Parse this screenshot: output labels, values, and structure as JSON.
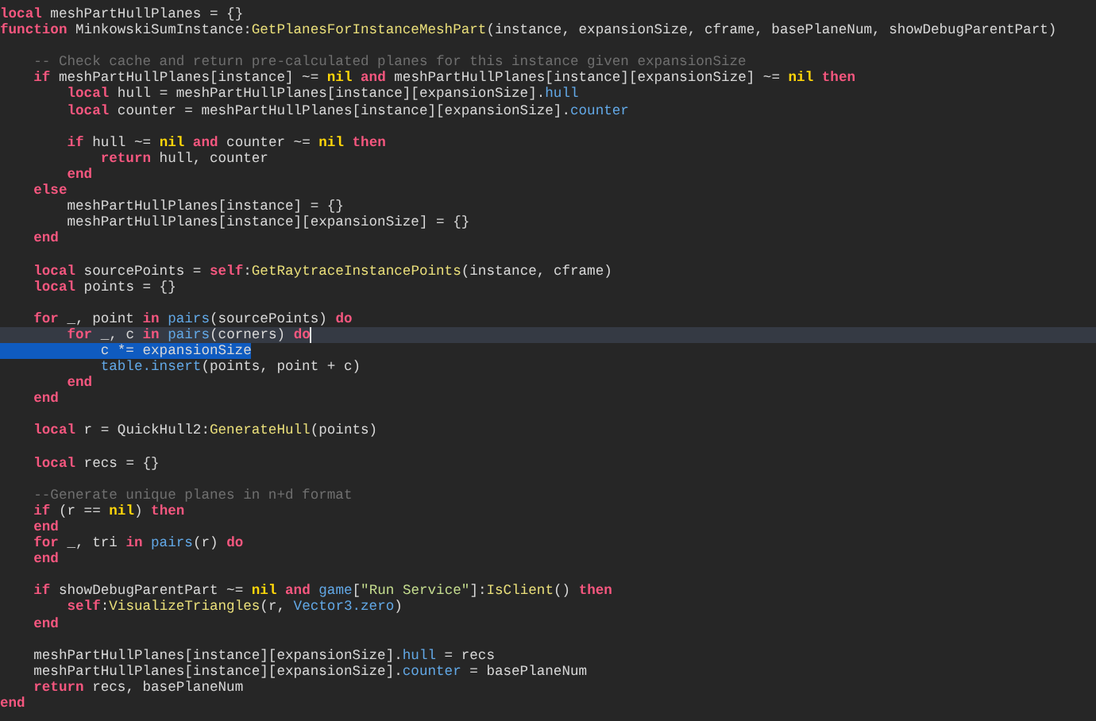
{
  "editor": {
    "blocks": [
      {
        "lines": [
          {
            "current": false,
            "selected": false,
            "tokens": [
              {
                "kind": "keyword",
                "text": "local"
              },
              {
                "kind": "text",
                "text": " meshPartHullPlanes = {}"
              }
            ]
          },
          {
            "current": false,
            "selected": false,
            "tokens": [
              {
                "kind": "keyword",
                "text": "function"
              },
              {
                "kind": "text",
                "text": " MinkowskiSumInstance:"
              },
              {
                "kind": "function",
                "text": "GetPlanesForInstanceMeshPart"
              },
              {
                "kind": "text",
                "text": "(instance, expansionSize, cframe, basePlaneNum, showDebugParentPart)"
              }
            ]
          }
        ]
      },
      {
        "lines": [
          {
            "current": false,
            "selected": false,
            "tokens": [
              {
                "kind": "comment",
                "text": "    -- Check cache and return pre-calculated planes for this instance given expansionSize"
              }
            ]
          },
          {
            "current": false,
            "selected": false,
            "tokens": [
              {
                "kind": "keyword",
                "text": "    if"
              },
              {
                "kind": "text",
                "text": " meshPartHullPlanes[instance] ~= "
              },
              {
                "kind": "constant",
                "text": "nil"
              },
              {
                "kind": "keyword",
                "text": " and"
              },
              {
                "kind": "text",
                "text": " meshPartHullPlanes[instance][expansionSize] ~= "
              },
              {
                "kind": "constant",
                "text": "nil"
              },
              {
                "kind": "keyword",
                "text": " then"
              }
            ]
          },
          {
            "current": false,
            "selected": false,
            "tokens": [
              {
                "kind": "keyword",
                "text": "        local"
              },
              {
                "kind": "text",
                "text": " hull = meshPartHullPlanes[instance][expansionSize]."
              },
              {
                "kind": "builtin",
                "text": "hull"
              }
            ]
          },
          {
            "current": false,
            "selected": false,
            "tokens": [
              {
                "kind": "keyword",
                "text": "        local"
              },
              {
                "kind": "text",
                "text": " counter = meshPartHullPlanes[instance][expansionSize]."
              },
              {
                "kind": "builtin",
                "text": "counter"
              }
            ]
          }
        ]
      },
      {
        "lines": [
          {
            "current": false,
            "selected": false,
            "tokens": [
              {
                "kind": "keyword",
                "text": "        if"
              },
              {
                "kind": "text",
                "text": " hull ~= "
              },
              {
                "kind": "constant",
                "text": "nil"
              },
              {
                "kind": "keyword",
                "text": " and"
              },
              {
                "kind": "text",
                "text": " counter ~= "
              },
              {
                "kind": "constant",
                "text": "nil"
              },
              {
                "kind": "keyword",
                "text": " then"
              }
            ]
          },
          {
            "current": false,
            "selected": false,
            "tokens": [
              {
                "kind": "keyword",
                "text": "            return"
              },
              {
                "kind": "text",
                "text": " hull, counter"
              }
            ]
          },
          {
            "current": false,
            "selected": false,
            "tokens": [
              {
                "kind": "keyword",
                "text": "        end"
              }
            ]
          },
          {
            "current": false,
            "selected": false,
            "tokens": [
              {
                "kind": "keyword",
                "text": "    else"
              }
            ]
          },
          {
            "current": false,
            "selected": false,
            "tokens": [
              {
                "kind": "text",
                "text": "        meshPartHullPlanes[instance] = {}"
              }
            ]
          },
          {
            "current": false,
            "selected": false,
            "tokens": [
              {
                "kind": "text",
                "text": "        meshPartHullPlanes[instance][expansionSize] = {}"
              }
            ]
          },
          {
            "current": false,
            "selected": false,
            "tokens": [
              {
                "kind": "keyword",
                "text": "    end"
              }
            ]
          }
        ]
      },
      {
        "lines": [
          {
            "current": false,
            "selected": false,
            "tokens": [
              {
                "kind": "keyword",
                "text": "    local"
              },
              {
                "kind": "text",
                "text": " sourcePoints = "
              },
              {
                "kind": "keyword",
                "text": "self"
              },
              {
                "kind": "text",
                "text": ":"
              },
              {
                "kind": "function",
                "text": "GetRaytraceInstancePoints"
              },
              {
                "kind": "text",
                "text": "(instance, cframe)"
              }
            ]
          },
          {
            "current": false,
            "selected": false,
            "tokens": [
              {
                "kind": "keyword",
                "text": "    local"
              },
              {
                "kind": "text",
                "text": " points = {}"
              }
            ]
          }
        ]
      },
      {
        "lines": [
          {
            "current": false,
            "selected": false,
            "tokens": [
              {
                "kind": "keyword",
                "text": "    for"
              },
              {
                "kind": "text",
                "text": " _, point "
              },
              {
                "kind": "keyword",
                "text": "in"
              },
              {
                "kind": "builtin",
                "text": " pairs"
              },
              {
                "kind": "text",
                "text": "(sourcePoints) "
              },
              {
                "kind": "keyword",
                "text": "do"
              }
            ]
          },
          {
            "current": true,
            "selected": false,
            "tokens": [
              {
                "kind": "keyword",
                "text": "        for"
              },
              {
                "kind": "text",
                "text": " _, c "
              },
              {
                "kind": "keyword",
                "text": "in"
              },
              {
                "kind": "builtin",
                "text": " pairs"
              },
              {
                "kind": "text",
                "text": "(corners) "
              },
              {
                "kind": "keyword",
                "text": "do"
              }
            ]
          },
          {
            "current": false,
            "selected": true,
            "tokens": [
              {
                "kind": "text",
                "text": "            c *= expansionSize"
              }
            ]
          },
          {
            "current": false,
            "selected": false,
            "tokens": [
              {
                "kind": "builtin",
                "text": "            table.insert"
              },
              {
                "kind": "text",
                "text": "(points, point + c)"
              }
            ]
          },
          {
            "current": false,
            "selected": false,
            "tokens": [
              {
                "kind": "keyword",
                "text": "        end"
              }
            ]
          },
          {
            "current": false,
            "selected": false,
            "tokens": [
              {
                "kind": "keyword",
                "text": "    end"
              }
            ]
          }
        ]
      },
      {
        "lines": [
          {
            "current": false,
            "selected": false,
            "tokens": [
              {
                "kind": "keyword",
                "text": "    local"
              },
              {
                "kind": "text",
                "text": " r = QuickHull2:"
              },
              {
                "kind": "function",
                "text": "GenerateHull"
              },
              {
                "kind": "text",
                "text": "(points)"
              }
            ]
          }
        ]
      },
      {
        "lines": [
          {
            "current": false,
            "selected": false,
            "tokens": [
              {
                "kind": "keyword",
                "text": "    local"
              },
              {
                "kind": "text",
                "text": " recs = {}"
              }
            ]
          }
        ]
      },
      {
        "lines": [
          {
            "current": false,
            "selected": false,
            "tokens": [
              {
                "kind": "comment",
                "text": "    --Generate unique planes in n+d format"
              }
            ]
          },
          {
            "current": false,
            "selected": false,
            "tokens": [
              {
                "kind": "keyword",
                "text": "    if"
              },
              {
                "kind": "text",
                "text": " (r == "
              },
              {
                "kind": "constant",
                "text": "nil"
              },
              {
                "kind": "text",
                "text": ") "
              },
              {
                "kind": "keyword",
                "text": "then"
              }
            ]
          },
          {
            "current": false,
            "selected": false,
            "tokens": [
              {
                "kind": "keyword",
                "text": "    end"
              }
            ]
          },
          {
            "current": false,
            "selected": false,
            "tokens": [
              {
                "kind": "keyword",
                "text": "    for"
              },
              {
                "kind": "text",
                "text": " _, tri "
              },
              {
                "kind": "keyword",
                "text": "in"
              },
              {
                "kind": "builtin",
                "text": " pairs"
              },
              {
                "kind": "text",
                "text": "(r) "
              },
              {
                "kind": "keyword",
                "text": "do"
              }
            ]
          },
          {
            "current": false,
            "selected": false,
            "tokens": [
              {
                "kind": "keyword",
                "text": "    end"
              }
            ]
          }
        ]
      },
      {
        "lines": [
          {
            "current": false,
            "selected": false,
            "tokens": [
              {
                "kind": "keyword",
                "text": "    if"
              },
              {
                "kind": "text",
                "text": " showDebugParentPart ~= "
              },
              {
                "kind": "constant",
                "text": "nil"
              },
              {
                "kind": "keyword",
                "text": " and"
              },
              {
                "kind": "builtin",
                "text": " game"
              },
              {
                "kind": "text",
                "text": "["
              },
              {
                "kind": "string",
                "text": "\"Run Service\""
              },
              {
                "kind": "text",
                "text": "]:"
              },
              {
                "kind": "function",
                "text": "IsClient"
              },
              {
                "kind": "text",
                "text": "() "
              },
              {
                "kind": "keyword",
                "text": "then"
              }
            ]
          },
          {
            "current": false,
            "selected": false,
            "tokens": [
              {
                "kind": "keyword",
                "text": "        self"
              },
              {
                "kind": "text",
                "text": ":"
              },
              {
                "kind": "function",
                "text": "VisualizeTriangles"
              },
              {
                "kind": "text",
                "text": "(r, "
              },
              {
                "kind": "builtin",
                "text": "Vector3.zero"
              },
              {
                "kind": "text",
                "text": ")"
              }
            ]
          },
          {
            "current": false,
            "selected": false,
            "tokens": [
              {
                "kind": "keyword",
                "text": "    end"
              }
            ]
          }
        ]
      },
      {
        "lines": [
          {
            "current": false,
            "selected": false,
            "tokens": [
              {
                "kind": "text",
                "text": "    meshPartHullPlanes[instance][expansionSize]."
              },
              {
                "kind": "builtin",
                "text": "hull"
              },
              {
                "kind": "text",
                "text": " = recs"
              }
            ]
          },
          {
            "current": false,
            "selected": false,
            "tokens": [
              {
                "kind": "text",
                "text": "    meshPartHullPlanes[instance][expansionSize]."
              },
              {
                "kind": "builtin",
                "text": "counter"
              },
              {
                "kind": "text",
                "text": " = basePlaneNum"
              }
            ]
          },
          {
            "current": false,
            "selected": false,
            "tokens": [
              {
                "kind": "keyword",
                "text": "    return"
              },
              {
                "kind": "text",
                "text": " recs, basePlaneNum"
              }
            ]
          },
          {
            "current": false,
            "selected": false,
            "tokens": [
              {
                "kind": "keyword",
                "text": "end"
              }
            ]
          }
        ]
      }
    ]
  }
}
